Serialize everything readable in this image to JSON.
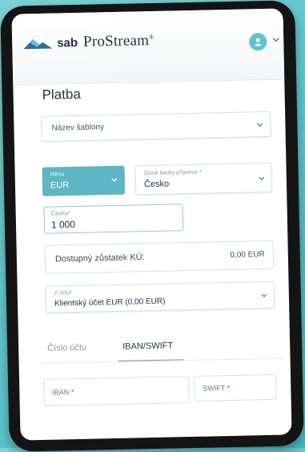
{
  "app": {
    "logo_brand": "sab",
    "logo_product": "ProStream",
    "logo_mark": "®"
  },
  "page": {
    "title": "Platba"
  },
  "template_select": {
    "placeholder": "Název šablony"
  },
  "currency": {
    "label": "Měna",
    "value": "EUR"
  },
  "country": {
    "label": "Země banky příjemce",
    "required_mark": "*",
    "value": "Česko"
  },
  "amount": {
    "label": "Částka",
    "required_mark": "*",
    "value": "1 000"
  },
  "balance": {
    "label": "Dostupný zůstatek KÚ:",
    "value": "0,00 EUR"
  },
  "from_account": {
    "label": "Z účtu",
    "required_mark": "*",
    "value": "Klientský účet EUR (0,00 EUR)"
  },
  "tabs": [
    {
      "label": "Číslo účtu",
      "active": false
    },
    {
      "label": "IBAN/SWIFT",
      "active": true
    }
  ],
  "iban": {
    "label": "IBAN",
    "required_mark": "*"
  },
  "swift": {
    "label": "SWIFT",
    "required_mark": "*"
  },
  "icons": {
    "logo": "sab-wave-logo",
    "avatar": "user-icon",
    "dropdown": "chevron-down-icon"
  },
  "colors": {
    "accent": "#5db6c4",
    "background": "#5cc4cc",
    "text": "#263445",
    "required": "#e0245e"
  }
}
